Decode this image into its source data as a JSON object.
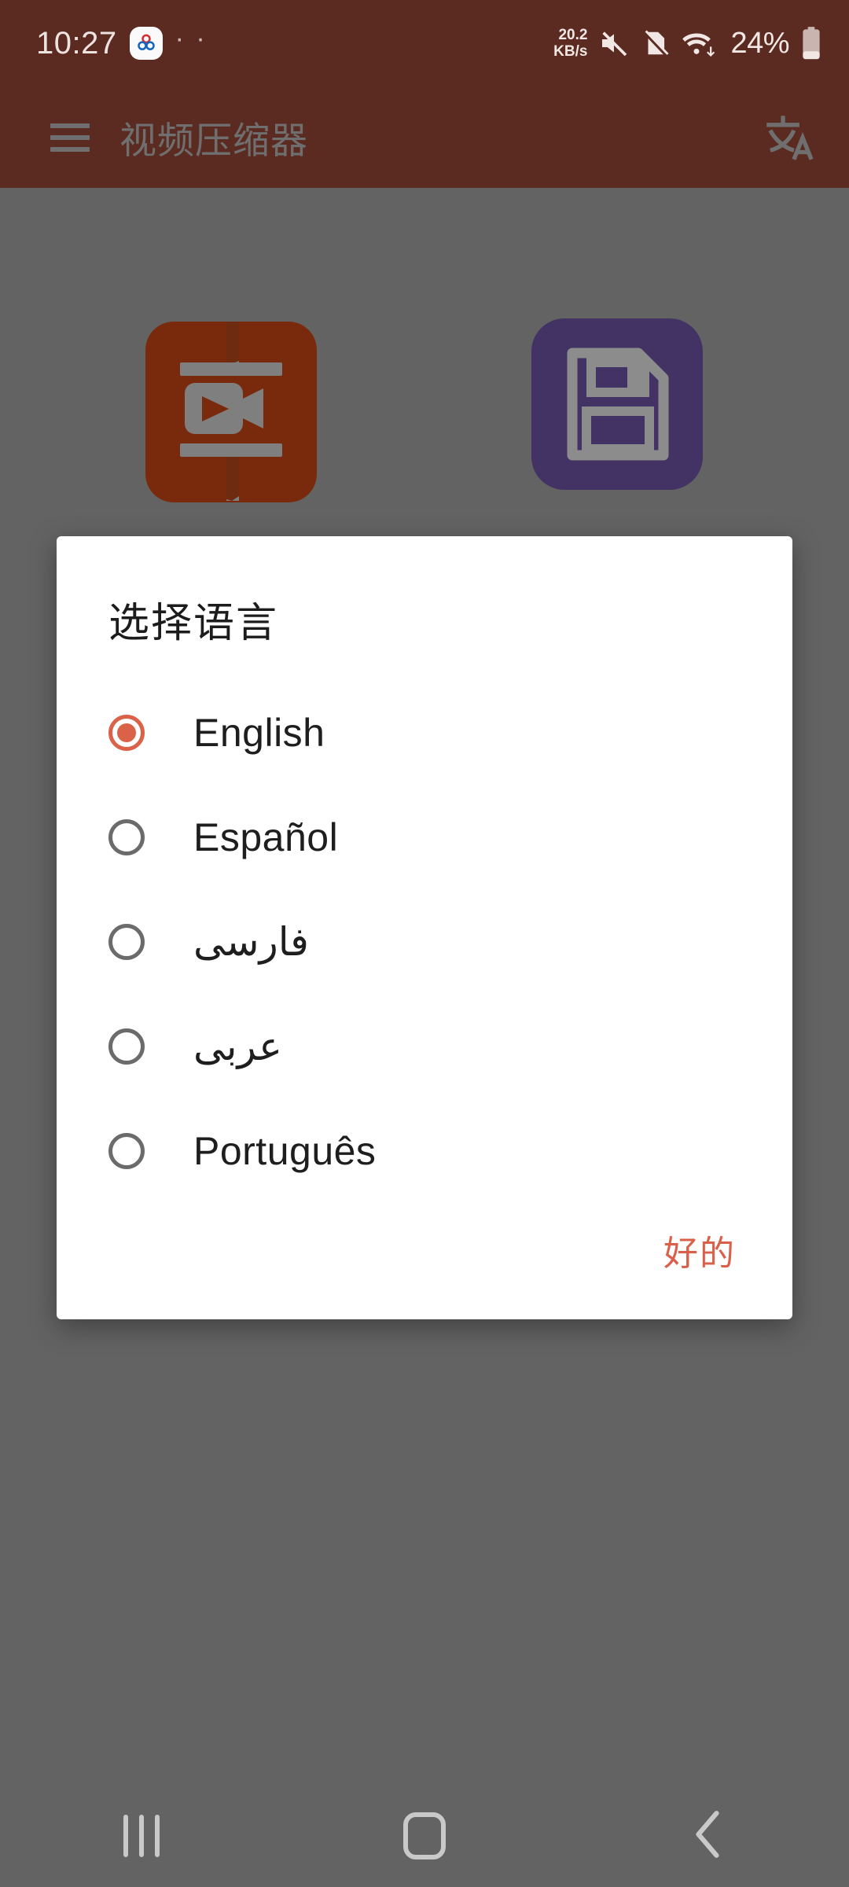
{
  "status_bar": {
    "time": "10:27",
    "notification_icon": "app-notification-icon",
    "overflow_dots": "· ·",
    "network_speed_value": "20.2",
    "network_speed_unit": "KB/s",
    "mute_icon": "volume-mute-icon",
    "nosim_icon": "no-sim-icon",
    "wifi_icon": "wifi-data-transfer-icon",
    "battery_percent": "24%",
    "battery_icon": "battery-low-icon",
    "background_color": "#5B2B21"
  },
  "app_bar": {
    "menu_icon": "hamburger-menu-icon",
    "title": "视频压缩器",
    "translate_icon": "translate-icon",
    "background_color": "#5B2B21",
    "dimmed_foreground_color": "#6F6F6F"
  },
  "content": {
    "shortcuts": [
      {
        "name": "video-compressor",
        "icon": "video-compress-icon",
        "tile_color": "#7A2A0C"
      },
      {
        "name": "save",
        "icon": "floppy-disk-save-icon",
        "tile_color": "#423364"
      }
    ],
    "scrim_color": "#636363"
  },
  "dialog": {
    "title": "选择语言",
    "options": [
      {
        "label": "English",
        "selected": true
      },
      {
        "label": "Español",
        "selected": false
      },
      {
        "label": "فارسی",
        "selected": false
      },
      {
        "label": "عربی",
        "selected": false
      },
      {
        "label": "Português",
        "selected": false
      }
    ],
    "ok_label": "好的",
    "accent_color": "#DA6249",
    "background_color": "#FFFFFF"
  },
  "nav_bar": {
    "recents_label": "recent-apps",
    "home_label": "home",
    "back_label": "back",
    "icon_color": "#C9C9C9"
  }
}
